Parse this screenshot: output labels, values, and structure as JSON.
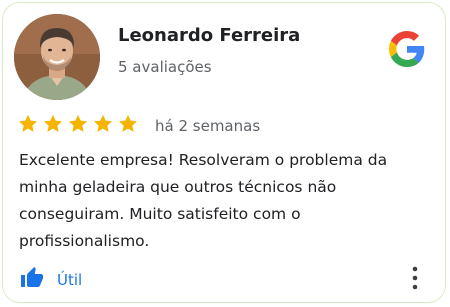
{
  "reviewer": {
    "name": "Leonardo Ferreira",
    "review_count": "5 avaliações",
    "avatar_icon": "person-photo"
  },
  "brand": {
    "logo_icon": "google-g-icon",
    "colors": {
      "blue": "#4285F4",
      "red": "#EA4335",
      "yellow": "#FBBC05",
      "green": "#34A853"
    }
  },
  "review": {
    "rating": 5,
    "rating_max": 5,
    "star_color": "#F5B400",
    "date": "há 2 semanas",
    "text": "Excelente empresa! Resolveram o problema da minha geladeira que outros técnicos não conseguiram. Muito satisfeito com o profissionalismo."
  },
  "actions": {
    "helpful_label": "Útil",
    "helpful_icon": "thumbs-up-icon",
    "more_icon": "more-vert-icon",
    "accent_color": "#1a73e8"
  }
}
